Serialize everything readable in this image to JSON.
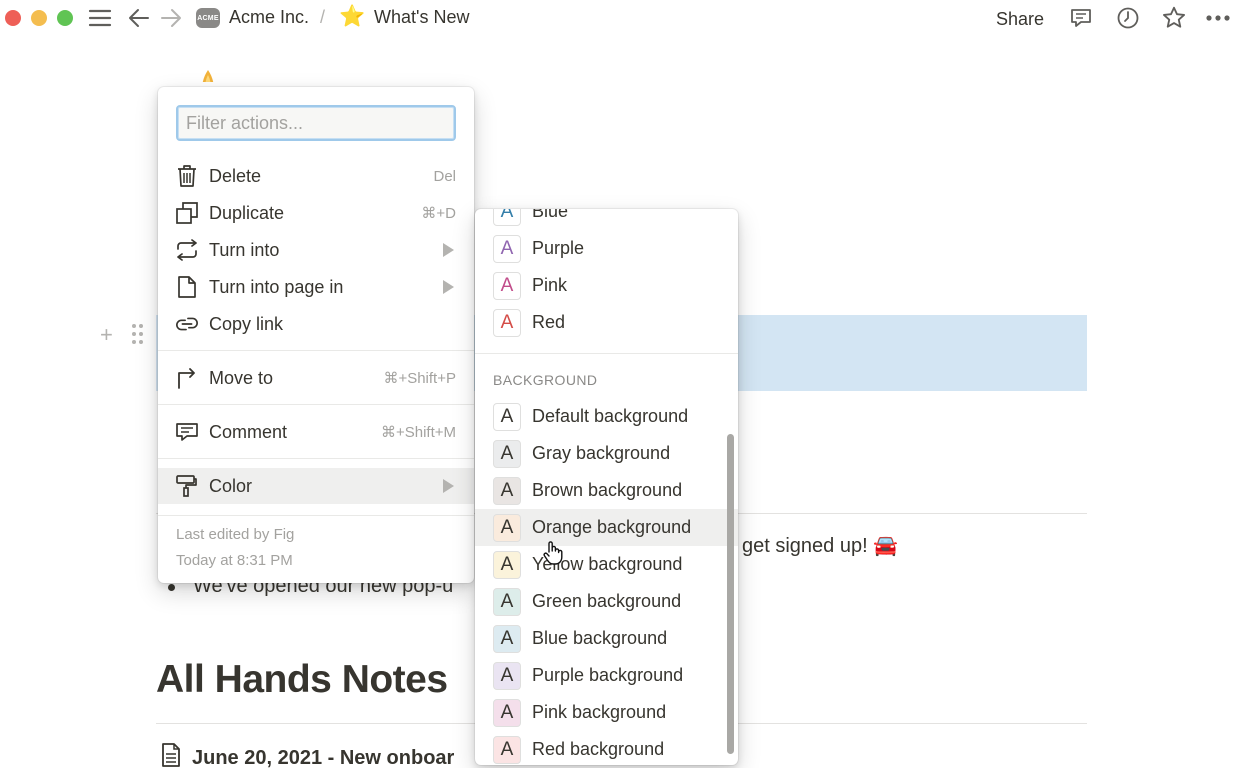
{
  "window": {
    "traffic_lights": [
      "close",
      "minimize",
      "maximize"
    ]
  },
  "topbar": {
    "workspace_logo": "ACME",
    "workspace_name": "Acme Inc.",
    "separator": "/",
    "page_emoji": "⭐",
    "page_title": "What's New",
    "share_label": "Share",
    "icons": [
      "sidebar-menu-icon",
      "back-arrow-icon",
      "forward-arrow-icon",
      "comments-icon",
      "updates-clock-icon",
      "favorite-star-icon",
      "more-dots-icon"
    ]
  },
  "page": {
    "partial_line_right": "get signed up! 🚘",
    "bullet_text": "We've opened our new pop-u",
    "heading": "All Hands Notes",
    "doc_link": "June 20, 2021 - New onboar",
    "highlight_color": "#d3e5f3"
  },
  "action_menu": {
    "filter_placeholder": "Filter actions...",
    "items": [
      {
        "label": "Delete",
        "shortcut": "Del",
        "icon": "trash-icon"
      },
      {
        "label": "Duplicate",
        "shortcut": "⌘+D",
        "icon": "duplicate-icon"
      },
      {
        "label": "Turn into",
        "shortcut": "",
        "icon": "turn-into-icon",
        "submenu": true
      },
      {
        "label": "Turn into page in",
        "shortcut": "",
        "icon": "page-icon",
        "submenu": true
      },
      {
        "label": "Copy link",
        "shortcut": "",
        "icon": "link-icon"
      },
      {
        "label": "Move to",
        "shortcut": "⌘+Shift+P",
        "icon": "move-to-icon"
      },
      {
        "label": "Comment",
        "shortcut": "⌘+Shift+M",
        "icon": "comment-icon"
      },
      {
        "label": "Color",
        "shortcut": "",
        "icon": "paint-roller-icon",
        "submenu": true,
        "active": true
      }
    ],
    "last_edited_by": "Last edited by Fig",
    "last_edited_time": "Today at 8:31 PM"
  },
  "color_menu": {
    "text_colors": [
      {
        "label": "Blue",
        "color": "#337ea9"
      },
      {
        "label": "Purple",
        "color": "#9065b0"
      },
      {
        "label": "Pink",
        "color": "#c14c8a"
      },
      {
        "label": "Red",
        "color": "#d44c47"
      }
    ],
    "background_section": "BACKGROUND",
    "background_colors": [
      {
        "label": "Default background",
        "bg": "#ffffff"
      },
      {
        "label": "Gray background",
        "bg": "#ebeced"
      },
      {
        "label": "Brown background",
        "bg": "#e9e5e3"
      },
      {
        "label": "Orange background",
        "bg": "#faebdd",
        "hover": true
      },
      {
        "label": "Yellow background",
        "bg": "#fbf3db"
      },
      {
        "label": "Green background",
        "bg": "#ddedea"
      },
      {
        "label": "Blue background",
        "bg": "#ddebf1"
      },
      {
        "label": "Purple background",
        "bg": "#eae4f2"
      },
      {
        "label": "Pink background",
        "bg": "#f4dfeb"
      },
      {
        "label": "Red background",
        "bg": "#fbe4e4"
      }
    ],
    "swatch_letter": "A"
  }
}
